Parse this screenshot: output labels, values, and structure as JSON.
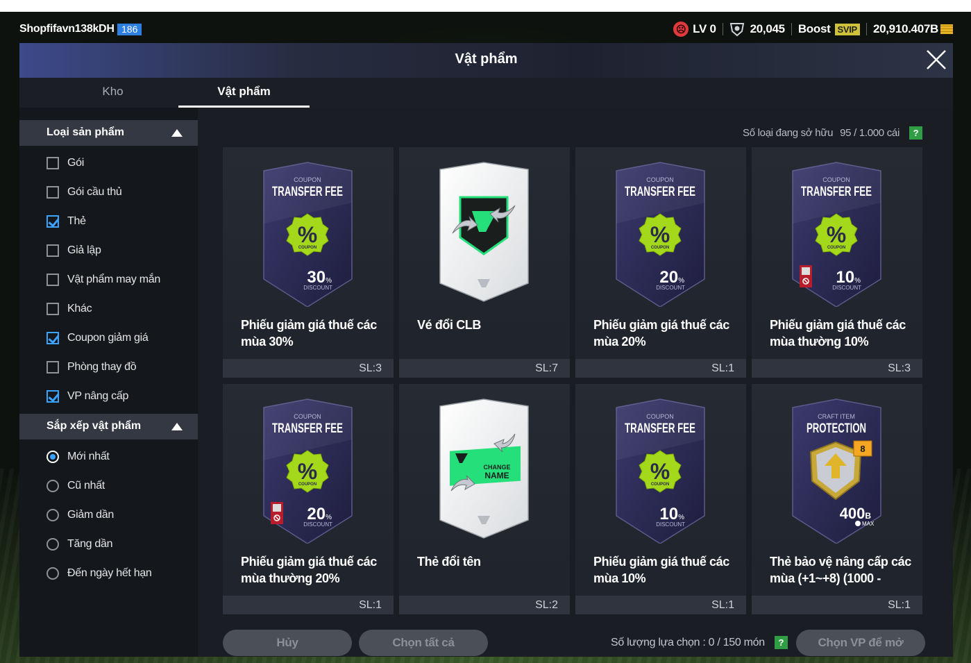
{
  "topbar": {
    "username": "Shopfifavn138kDH",
    "user_level": "186",
    "level_label": "LV 0",
    "trophy_value": "20,045",
    "boost_label": "Boost",
    "svip_label": "SVIP",
    "coins": "20,910.407B"
  },
  "panel": {
    "title": "Vật phẩm"
  },
  "tabs": [
    {
      "label": "Kho",
      "active": false
    },
    {
      "label": "Vật phẩm",
      "active": true
    }
  ],
  "filter": {
    "title": "Loại sản phẩm",
    "options": [
      {
        "label": "Gói",
        "checked": false
      },
      {
        "label": "Gói cầu thủ",
        "checked": false
      },
      {
        "label": "Thẻ",
        "checked": true
      },
      {
        "label": "Giả lập",
        "checked": false
      },
      {
        "label": "Vật phẩm may mắn",
        "checked": false
      },
      {
        "label": "Khác",
        "checked": false
      },
      {
        "label": "Coupon giảm giá",
        "checked": true
      },
      {
        "label": "Phòng thay đồ",
        "checked": false
      },
      {
        "label": "VP nâng cấp",
        "checked": true
      }
    ]
  },
  "sort": {
    "title": "Sắp xếp vật phẩm",
    "options": [
      {
        "label": "Mới nhất",
        "selected": true
      },
      {
        "label": "Cũ nhất",
        "selected": false
      },
      {
        "label": "Giảm dần",
        "selected": false
      },
      {
        "label": "Tăng dần",
        "selected": false
      },
      {
        "label": "Đến ngày hết hạn",
        "selected": false
      }
    ]
  },
  "owned": {
    "label": "Số loại đang sở hữu",
    "count": "95 / 1.000 cái",
    "help": "?"
  },
  "items": [
    {
      "name": "Phiếu giảm giá thuế các mùa 30%",
      "qty": "SL:3",
      "kind": "coupon",
      "top_small": "COUPON",
      "top_big": "TRANSFER FEE",
      "badge_small": "COUPON",
      "value": "30",
      "unit": "%",
      "sub": "DISCOUNT",
      "restricted": false
    },
    {
      "name": "Vé đổi CLB",
      "qty": "SL:7",
      "kind": "club"
    },
    {
      "name": "Phiếu giảm giá thuế các mùa 20%",
      "qty": "SL:1",
      "kind": "coupon",
      "top_small": "COUPON",
      "top_big": "TRANSFER FEE",
      "badge_small": "COUPON",
      "value": "20",
      "unit": "%",
      "sub": "DISCOUNT",
      "restricted": false
    },
    {
      "name": "Phiếu giảm giá thuế các mùa thường 10%",
      "qty": "SL:3",
      "kind": "coupon",
      "top_small": "COUPON",
      "top_big": "TRANSFER FEE",
      "badge_small": "COUPON",
      "value": "10",
      "unit": "%",
      "sub": "DISCOUNT",
      "restricted": true
    },
    {
      "name": "Phiếu giảm giá thuế các mùa thường 20%",
      "qty": "SL:1",
      "kind": "coupon",
      "top_small": "COUPON",
      "top_big": "TRANSFER FEE",
      "badge_small": "COUPON",
      "value": "20",
      "unit": "%",
      "sub": "DISCOUNT",
      "restricted": true
    },
    {
      "name": "Thẻ đổi tên",
      "qty": "SL:2",
      "kind": "rename",
      "label_top": "CHANGE",
      "label_bottom": "NAME"
    },
    {
      "name": "Phiếu giảm giá thuế các mùa 10%",
      "qty": "SL:1",
      "kind": "coupon",
      "top_small": "COUPON",
      "top_big": "TRANSFER FEE",
      "badge_small": "COUPON",
      "value": "10",
      "unit": "%",
      "sub": "DISCOUNT",
      "restricted": false
    },
    {
      "name": "Thẻ bảo vệ nâng cấp các mùa (+1~+8) (1000 -",
      "qty": "SL:1",
      "kind": "protect",
      "top_small": "CRAFT ITEM",
      "top_big": "PROTECTION",
      "level": "8",
      "value": "400",
      "unit": "B",
      "sub": "MAX"
    }
  ],
  "bottom": {
    "cancel_label": "Hủy",
    "select_all_label": "Chọn tất cả",
    "select_count_label": "Số lượng lựa chọn : 0 / 150 món",
    "help": "?",
    "open_label": "Chọn VP để mở"
  },
  "colors": {
    "accent": "#3aa3ff",
    "card_bg": "#262a33",
    "coupon_badge": "#9ad600",
    "help_green": "#2f9e44"
  }
}
